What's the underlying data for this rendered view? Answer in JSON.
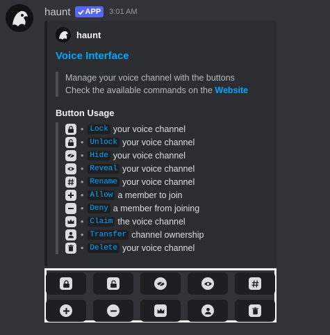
{
  "message": {
    "username": "haunt",
    "badge": "APP",
    "timestamp": "3:01 AM"
  },
  "embed": {
    "author": "haunt",
    "title": "Voice Interface",
    "description_line1": "Manage your voice channel with the buttons",
    "description_line2_prefix": "Check the available commands on the ",
    "description_link": "Website",
    "section_title": "Button Usage",
    "usage": [
      {
        "icon": "lock-icon",
        "cmd": "Lock",
        "text": "your voice channel"
      },
      {
        "icon": "unlock-icon",
        "cmd": "Unlock",
        "text": "your voice channel"
      },
      {
        "icon": "eye-off-icon",
        "cmd": "Hide",
        "text": "your voice channel"
      },
      {
        "icon": "eye-icon",
        "cmd": "Reveal",
        "text": "your voice channel"
      },
      {
        "icon": "hash-icon",
        "cmd": "Rename",
        "text": "your voice channel"
      },
      {
        "icon": "plus-icon",
        "cmd": "Allow",
        "text": "a member to join"
      },
      {
        "icon": "minus-icon",
        "cmd": "Deny",
        "text": "a member from joining"
      },
      {
        "icon": "crown-icon",
        "cmd": "Claim",
        "text": "the voice channel"
      },
      {
        "icon": "user-icon",
        "cmd": "Transfer",
        "text": "channel ownership"
      },
      {
        "icon": "trash-icon",
        "cmd": "Delete",
        "text": "your voice channel"
      }
    ]
  },
  "buttons": [
    "lock-icon",
    "unlock-icon",
    "eye-off-icon",
    "eye-icon",
    "hash-icon",
    "plus-icon",
    "minus-icon",
    "crown-icon",
    "user-icon",
    "trash-icon"
  ],
  "colors": {
    "background": "#313338",
    "embed_bg": "#2b2d31",
    "link": "#00a8fc",
    "badge": "#5865f2"
  }
}
